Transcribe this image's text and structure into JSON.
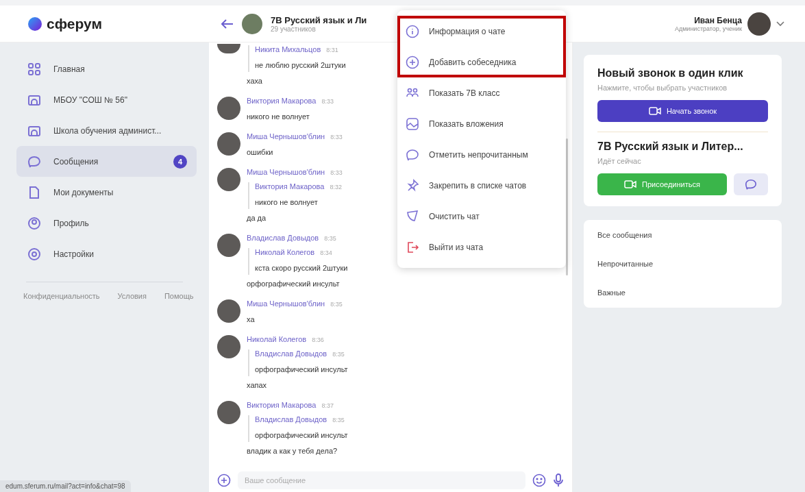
{
  "logo": {
    "text": "сферум"
  },
  "chat_header": {
    "title": "7В Русский язык и Ли",
    "subtitle": "29 участников"
  },
  "user": {
    "name": "Иван Бенца",
    "role": "Администратор, ученик"
  },
  "sidebar": {
    "items": [
      {
        "label": "Главная",
        "selected": false
      },
      {
        "label": "МБОУ \"СОШ № 56\"",
        "selected": false
      },
      {
        "label": "Школа обучения админист...",
        "selected": false
      },
      {
        "label": "Сообщения",
        "selected": true,
        "badge": "4"
      },
      {
        "label": "Мои документы",
        "selected": false
      },
      {
        "label": "Профиль",
        "selected": false
      },
      {
        "label": "Настройки",
        "selected": false
      }
    ],
    "footer_links": [
      "Конфиденциальность",
      "Условия",
      "Помощь"
    ]
  },
  "messages": [
    {
      "quote": {
        "author": "Никита Михальцов",
        "time": "8:31",
        "text": "не люблю русский 2штуки"
      },
      "text": "хаха"
    },
    {
      "author": "Виктория Макарова",
      "time": "8:33",
      "text": "никого не волнует"
    },
    {
      "author": "Миша Чернышов'блин",
      "time": "8:33",
      "text": "ошибки"
    },
    {
      "author": "Миша Чернышов'блин",
      "time": "8:33",
      "quote": {
        "author": "Виктория Макарова",
        "time": "8:32",
        "text": "никого не волнует"
      },
      "text": "да да"
    },
    {
      "author": "Владислав Довыдов",
      "time": "8:35",
      "quote": {
        "author": "Николай Колегов",
        "time": "8:34",
        "text": "кста скоро русский 2штуки"
      },
      "text": "орфографический инсульт"
    },
    {
      "author": "Миша Чернышов'блин",
      "time": "8:35",
      "text": "ха"
    },
    {
      "author": "Николай Колегов",
      "time": "8:36",
      "quote": {
        "author": "Владислав Довыдов",
        "time": "8:35",
        "text": "орфографический инсульт"
      },
      "text": "хапах"
    },
    {
      "author": "Виктория Макарова",
      "time": "8:37",
      "quote": {
        "author": "Владислав Довыдов",
        "time": "8:35",
        "text": "орфографический инсульт"
      },
      "text": "владик а как у тебя дела?"
    }
  ],
  "composer": {
    "placeholder": "Ваше сообщение"
  },
  "menu": [
    {
      "label": "Информация о чате",
      "kind": "normal",
      "highlighted": true
    },
    {
      "label": "Добавить собеседника",
      "kind": "normal",
      "highlighted": true
    },
    {
      "label": "Показать 7В класс",
      "kind": "normal",
      "highlighted": false
    },
    {
      "label": "Показать вложения",
      "kind": "normal",
      "highlighted": false
    },
    {
      "label": "Отметить непрочитанным",
      "kind": "normal",
      "highlighted": false
    },
    {
      "label": "Закрепить в списке чатов",
      "kind": "normal",
      "highlighted": false
    },
    {
      "label": "Очистить чат",
      "kind": "normal",
      "highlighted": false
    },
    {
      "label": "Выйти из чата",
      "kind": "danger",
      "highlighted": false
    }
  ],
  "call_card": {
    "title": "Новый звонок в один клик",
    "hint": "Нажмите, чтобы выбрать участников",
    "button": "Начать звонок"
  },
  "live_call": {
    "title": "7В Русский язык и Литер...",
    "status": "Идёт сейчас",
    "button": "Присоединиться"
  },
  "filters": [
    "Все сообщения",
    "Непрочитанные",
    "Важные"
  ],
  "status_url": "edum.sferum.ru/mail?act=info&chat=98"
}
